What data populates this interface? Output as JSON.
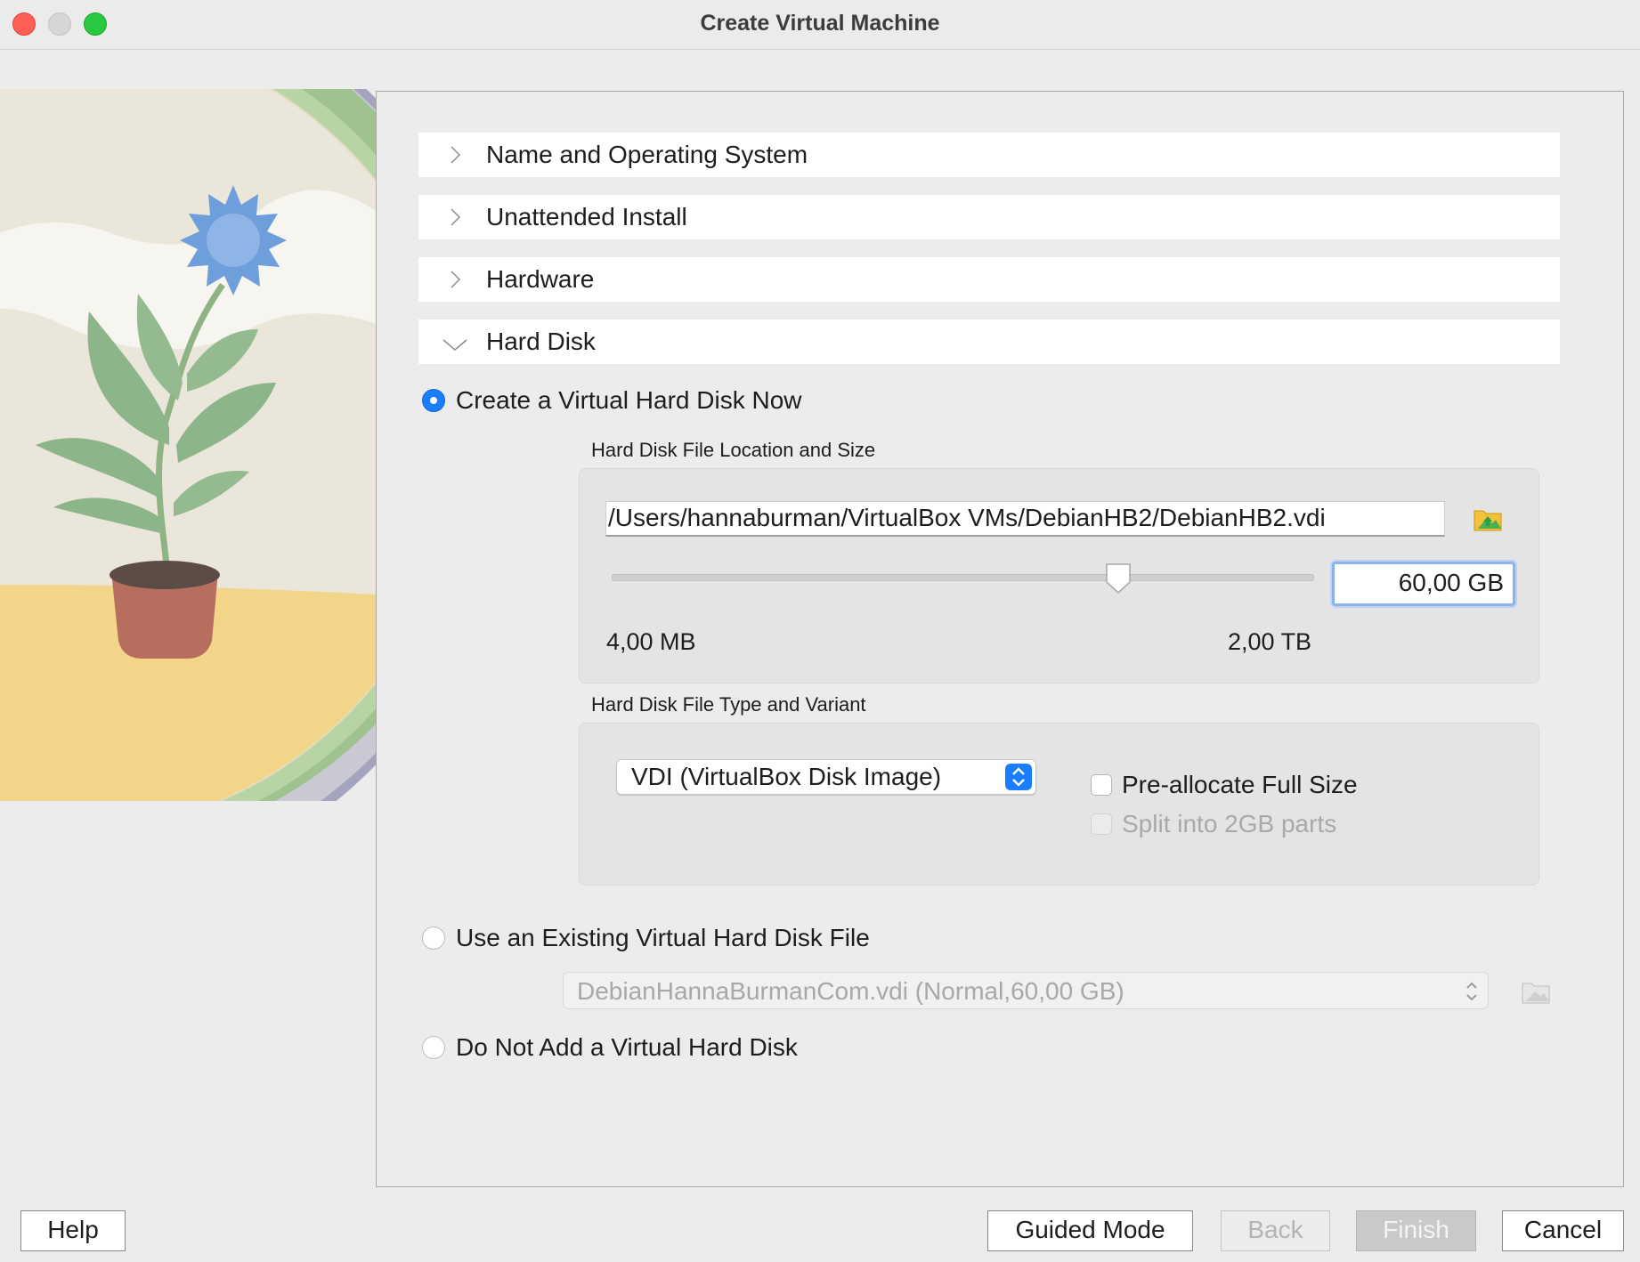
{
  "window": {
    "title": "Create Virtual Machine"
  },
  "sections": [
    {
      "label": "Name and Operating System",
      "expanded": false
    },
    {
      "label": "Unattended Install",
      "expanded": false
    },
    {
      "label": "Hardware",
      "expanded": false
    },
    {
      "label": "Hard Disk",
      "expanded": true
    }
  ],
  "hard_disk": {
    "options": {
      "create_now": {
        "label": "Create a Virtual Hard Disk Now",
        "selected": true
      },
      "use_existing": {
        "label": "Use an Existing Virtual Hard Disk File",
        "selected": false
      },
      "do_not_add": {
        "label": "Do Not Add a Virtual Hard Disk",
        "selected": false
      }
    },
    "location_group_title": "Hard Disk File Location and Size",
    "file_path": "/Users/hannaburman/VirtualBox VMs/DebianHB2/DebianHB2.vdi",
    "size_value": "60,00 GB",
    "size_min_label": "4,00 MB",
    "size_max_label": "2,00 TB",
    "type_group_title": "Hard Disk File Type and Variant",
    "file_type": "VDI (VirtualBox Disk Image)",
    "preallocate_label": "Pre-allocate Full Size",
    "preallocate_checked": false,
    "split_label": "Split into 2GB parts",
    "split_enabled": false,
    "existing_disk": "DebianHannaBurmanCom.vdi (Normal,60,00 GB)"
  },
  "buttons": {
    "help": "Help",
    "guided_mode": "Guided Mode",
    "back": "Back",
    "finish": "Finish",
    "cancel": "Cancel"
  },
  "colors": {
    "accent": "#1a7dfb",
    "window_bg": "#ececec",
    "focus_ring": "#8fb2ec"
  },
  "icons": {
    "section_collapsed": "chevron-right-icon",
    "section_expanded": "chevron-down-icon",
    "folder": "folder-icon",
    "select_arrows": "up-down-arrows-icon"
  }
}
